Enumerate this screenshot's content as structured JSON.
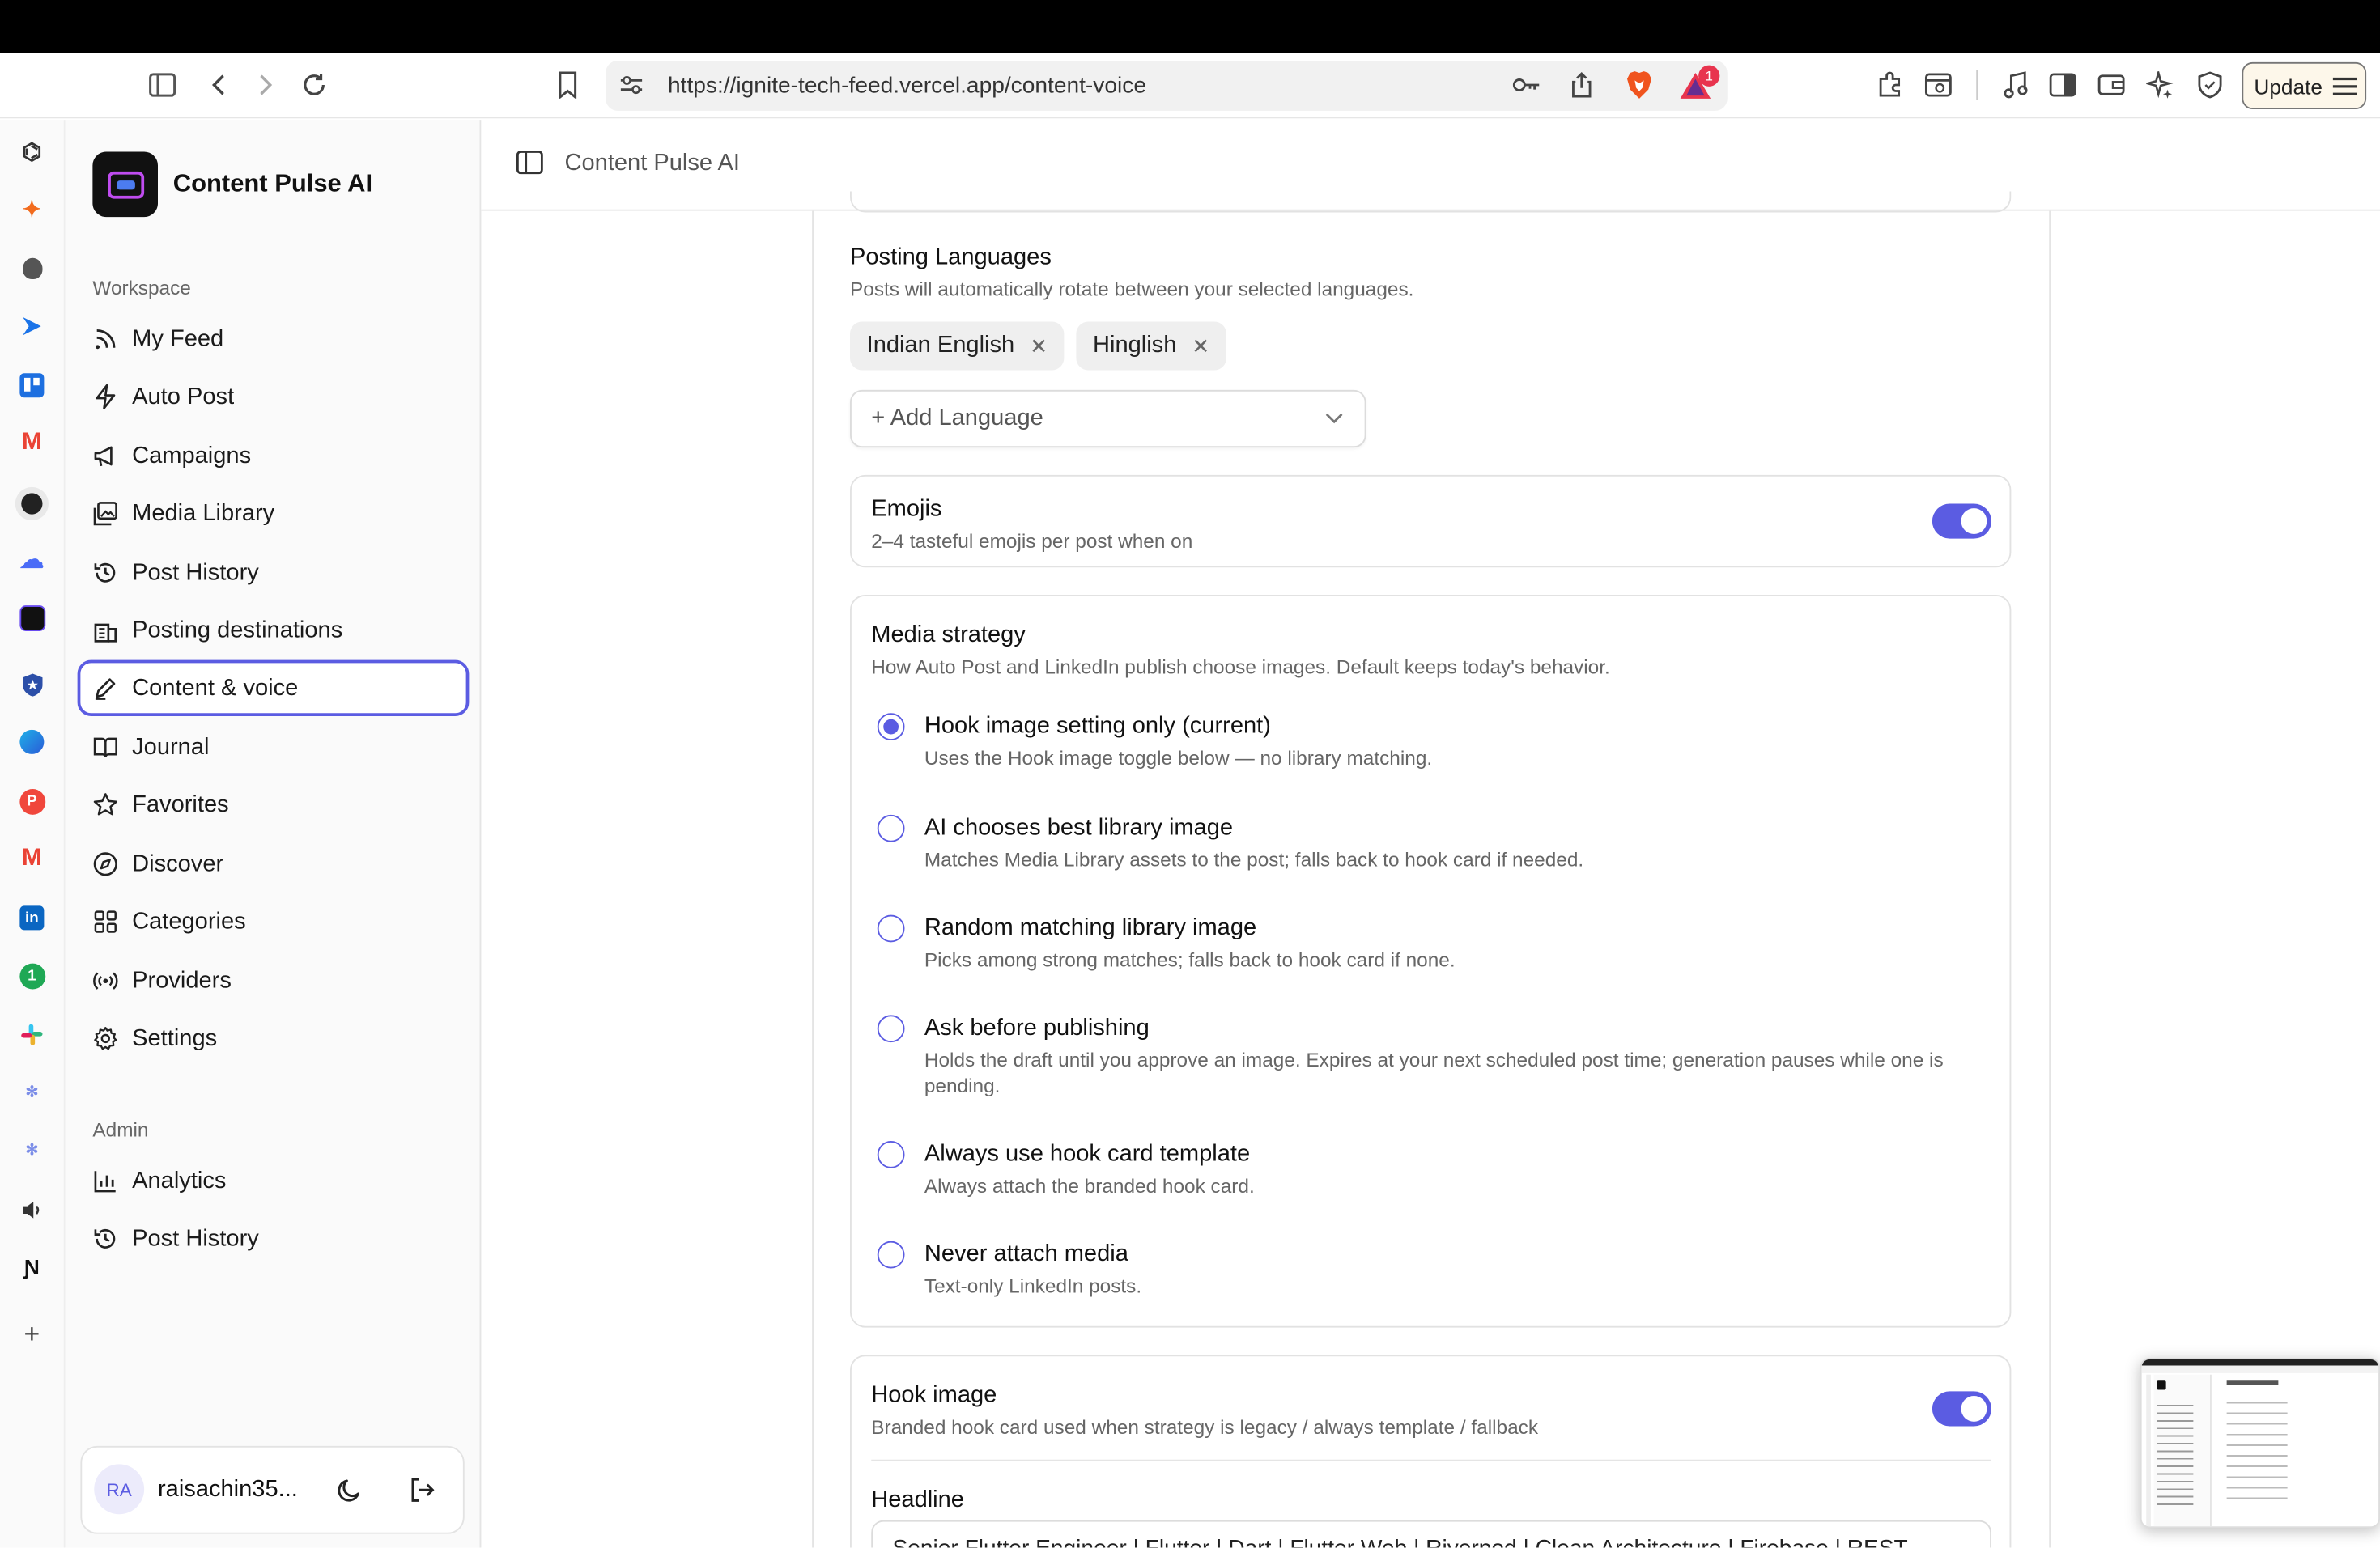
{
  "browser": {
    "url": "https://ignite-tech-feed.vercel.app/content-voice",
    "update_label": "Update",
    "shield_badge": "1"
  },
  "app": {
    "name": "Content Pulse AI",
    "logo_text": "ContentPulse"
  },
  "sidebar": {
    "workspace_heading": "Workspace",
    "items": [
      {
        "label": "My Feed",
        "icon": "rss-icon"
      },
      {
        "label": "Auto Post",
        "icon": "lightning-icon"
      },
      {
        "label": "Campaigns",
        "icon": "megaphone-icon"
      },
      {
        "label": "Media Library",
        "icon": "images-icon"
      },
      {
        "label": "Post History",
        "icon": "history-icon"
      },
      {
        "label": "Posting destinations",
        "icon": "building-icon"
      },
      {
        "label": "Content & voice",
        "icon": "pen-icon",
        "active": true
      },
      {
        "label": "Journal",
        "icon": "book-icon"
      },
      {
        "label": "Favorites",
        "icon": "star-icon"
      },
      {
        "label": "Discover",
        "icon": "compass-icon"
      },
      {
        "label": "Categories",
        "icon": "grid-icon"
      },
      {
        "label": "Providers",
        "icon": "radio-waves-icon"
      },
      {
        "label": "Settings",
        "icon": "gear-icon"
      }
    ],
    "admin_heading": "Admin",
    "admin_items": [
      {
        "label": "Analytics",
        "icon": "bar-chart-icon"
      },
      {
        "label": "Post History",
        "icon": "history-icon"
      }
    ],
    "user": {
      "initials": "RA",
      "name": "raisachin35..."
    }
  },
  "header": {
    "title": "Content Pulse AI"
  },
  "languages": {
    "title": "Posting Languages",
    "subtitle": "Posts will automatically rotate between your selected languages.",
    "selected": [
      "Indian English",
      "Hinglish"
    ],
    "add_placeholder": "+ Add Language"
  },
  "emojis": {
    "title": "Emojis",
    "subtitle": "2–4 tasteful emojis per post when on",
    "enabled": true
  },
  "media_strategy": {
    "title": "Media strategy",
    "subtitle": "How Auto Post and LinkedIn publish choose images. Default keeps today's behavior.",
    "options": [
      {
        "label": "Hook image setting only (current)",
        "desc": "Uses the Hook image toggle below — no library matching.",
        "selected": true
      },
      {
        "label": "AI chooses best library image",
        "desc": "Matches Media Library assets to the post; falls back to hook card if needed.",
        "selected": false
      },
      {
        "label": "Random matching library image",
        "desc": "Picks among strong matches; falls back to hook card if none.",
        "selected": false
      },
      {
        "label": "Ask before publishing",
        "desc": "Holds the draft until you approve an image. Expires at your next scheduled post time; generation pauses while one is pending.",
        "selected": false
      },
      {
        "label": "Always use hook card template",
        "desc": "Always attach the branded hook card.",
        "selected": false
      },
      {
        "label": "Never attach media",
        "desc": "Text-only LinkedIn posts.",
        "selected": false
      }
    ]
  },
  "hook_image": {
    "title": "Hook image",
    "subtitle": "Branded hook card used when strategy is legacy / always template / fallback",
    "enabled": true,
    "headline_label": "Headline",
    "headline_value": "Senior Flutter Engineer | Flutter | Dart | Flutter Web | Riverpod | Clean Architecture | Firebase | REST"
  },
  "colors": {
    "accent": "#5b5ce2"
  }
}
